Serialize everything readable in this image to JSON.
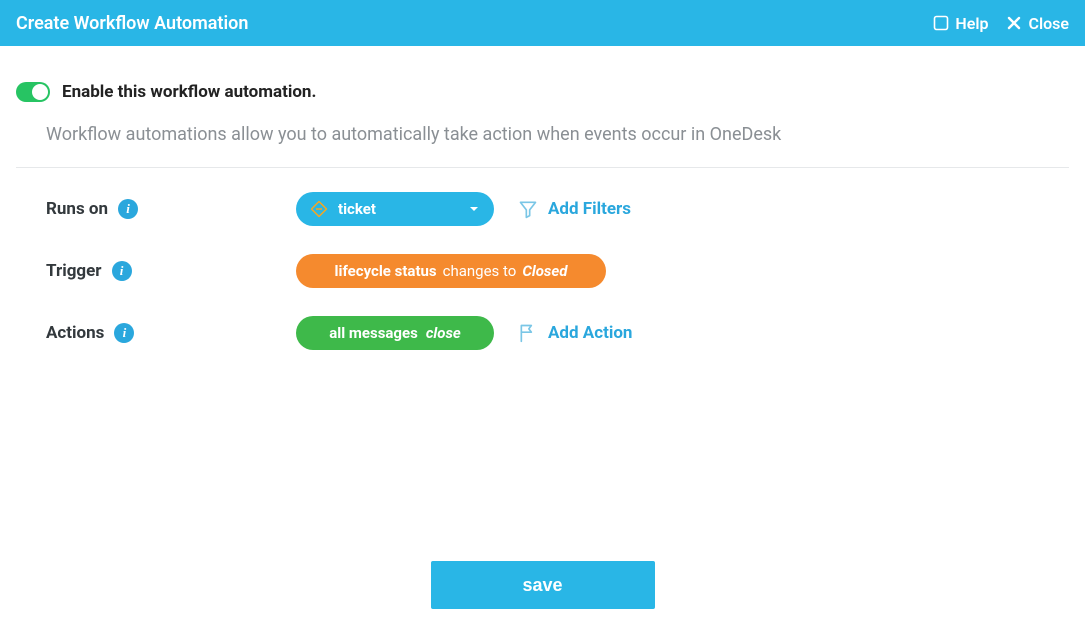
{
  "titlebar": {
    "title": "Create Workflow Automation",
    "help": "Help",
    "close": "Close"
  },
  "enable": {
    "label": "Enable this workflow automation."
  },
  "description": "Workflow automations allow you to automatically take action when events occur in OneDesk",
  "rows": {
    "runs_on": {
      "label": "Runs on",
      "value": "ticket",
      "add_filters": "Add Filters"
    },
    "trigger": {
      "label": "Trigger",
      "field": "lifecycle status",
      "verb": "changes to",
      "value": "Closed"
    },
    "actions": {
      "label": "Actions",
      "target": "all messages",
      "op": "close",
      "add_action": "Add Action"
    }
  },
  "save": "save"
}
